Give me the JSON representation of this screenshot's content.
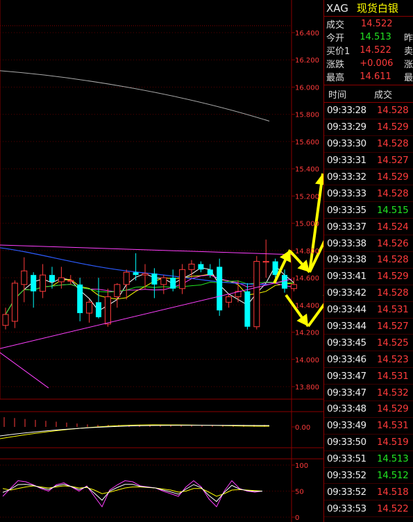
{
  "symbol": {
    "code": "XAG",
    "name": "现货白银"
  },
  "quote": [
    {
      "label": "成交",
      "value": "14.522",
      "color": "#ff3b3b",
      "extra": ""
    },
    {
      "label": "今开",
      "value": "14.513",
      "color": "#22e322",
      "extra": "昨"
    },
    {
      "label": "买价1",
      "value": "14.522",
      "color": "#ff3b3b",
      "extra": "卖"
    },
    {
      "label": "涨跌",
      "value": "+0.006",
      "color": "#ff3b3b",
      "extra": "涨"
    },
    {
      "label": "最高",
      "value": "14.611",
      "color": "#ff3b3b",
      "extra": "最"
    }
  ],
  "trades_header": {
    "time": "时间",
    "price": "成交"
  },
  "trades": [
    {
      "time": "09:33:28",
      "price": "14.528",
      "dir": "up"
    },
    {
      "time": "09:33:29",
      "price": "14.529",
      "dir": "up"
    },
    {
      "time": "09:33:30",
      "price": "14.528",
      "dir": "up"
    },
    {
      "time": "09:33:31",
      "price": "14.527",
      "dir": "up"
    },
    {
      "time": "09:33:32",
      "price": "14.529",
      "dir": "up"
    },
    {
      "time": "09:33:33",
      "price": "14.528",
      "dir": "up"
    },
    {
      "time": "09:33:35",
      "price": "14.515",
      "dir": "down"
    },
    {
      "time": "09:33:37",
      "price": "14.524",
      "dir": "up"
    },
    {
      "time": "09:33:38",
      "price": "14.526",
      "dir": "up"
    },
    {
      "time": "09:33:38",
      "price": "14.528",
      "dir": "up"
    },
    {
      "time": "09:33:41",
      "price": "14.529",
      "dir": "up"
    },
    {
      "time": "09:33:42",
      "price": "14.528",
      "dir": "up"
    },
    {
      "time": "09:33:44",
      "price": "14.531",
      "dir": "up"
    },
    {
      "time": "09:33:44",
      "price": "14.527",
      "dir": "up"
    },
    {
      "time": "09:33:45",
      "price": "14.525",
      "dir": "up"
    },
    {
      "time": "09:33:46",
      "price": "14.523",
      "dir": "up"
    },
    {
      "time": "09:33:47",
      "price": "14.531",
      "dir": "up"
    },
    {
      "time": "09:33:47",
      "price": "14.532",
      "dir": "up"
    },
    {
      "time": "09:33:48",
      "price": "14.529",
      "dir": "up"
    },
    {
      "time": "09:33:49",
      "price": "14.531",
      "dir": "up"
    },
    {
      "time": "09:33:50",
      "price": "14.519",
      "dir": "up"
    },
    {
      "time": "09:33:51",
      "price": "14.513",
      "dir": "down"
    },
    {
      "time": "09:33:52",
      "price": "14.512",
      "dir": "down"
    },
    {
      "time": "09:33:52",
      "price": "14.518",
      "dir": "up"
    },
    {
      "time": "09:33:53",
      "price": "14.522",
      "dir": "up"
    }
  ],
  "chart_data": {
    "type": "candlestick",
    "price_axis": {
      "ticks": [
        "16.400",
        "16.200",
        "16.000",
        "15.800",
        "15.600",
        "15.400",
        "15.200",
        "15.000",
        "14.800",
        "14.600",
        "14.400",
        "14.200",
        "14.000",
        "13.800"
      ],
      "min": 13.8,
      "max": 16.4
    },
    "candles": [
      {
        "o": 14.25,
        "h": 14.38,
        "l": 14.22,
        "c": 14.33
      },
      {
        "o": 14.28,
        "h": 14.58,
        "l": 14.23,
        "c": 14.56
      },
      {
        "o": 14.55,
        "h": 14.75,
        "l": 14.42,
        "c": 14.65
      },
      {
        "o": 14.62,
        "h": 14.64,
        "l": 14.38,
        "c": 14.5
      },
      {
        "o": 14.5,
        "h": 14.7,
        "l": 14.45,
        "c": 14.62
      },
      {
        "o": 14.62,
        "h": 14.68,
        "l": 14.52,
        "c": 14.57
      },
      {
        "o": 14.57,
        "h": 14.68,
        "l": 14.52,
        "c": 14.6
      },
      {
        "o": 14.58,
        "h": 14.62,
        "l": 14.55,
        "c": 14.58
      },
      {
        "o": 14.55,
        "h": 14.6,
        "l": 14.28,
        "c": 14.34
      },
      {
        "o": 14.34,
        "h": 14.44,
        "l": 14.27,
        "c": 14.42
      },
      {
        "o": 14.42,
        "h": 14.6,
        "l": 14.3,
        "c": 14.31
      },
      {
        "o": 14.26,
        "h": 14.52,
        "l": 14.24,
        "c": 14.46
      },
      {
        "o": 14.46,
        "h": 14.56,
        "l": 14.38,
        "c": 14.55
      },
      {
        "o": 14.55,
        "h": 14.66,
        "l": 14.44,
        "c": 14.64
      },
      {
        "o": 14.64,
        "h": 14.78,
        "l": 14.58,
        "c": 14.62
      },
      {
        "o": 14.62,
        "h": 14.7,
        "l": 14.52,
        "c": 14.63
      },
      {
        "o": 14.63,
        "h": 14.67,
        "l": 14.45,
        "c": 14.55
      },
      {
        "o": 14.55,
        "h": 14.62,
        "l": 14.48,
        "c": 14.6
      },
      {
        "o": 14.6,
        "h": 14.66,
        "l": 14.5,
        "c": 14.52
      },
      {
        "o": 14.52,
        "h": 14.7,
        "l": 14.48,
        "c": 14.66
      },
      {
        "o": 14.66,
        "h": 14.73,
        "l": 14.6,
        "c": 14.7
      },
      {
        "o": 14.7,
        "h": 14.72,
        "l": 14.64,
        "c": 14.66
      },
      {
        "o": 14.66,
        "h": 14.7,
        "l": 14.6,
        "c": 14.62
      },
      {
        "o": 14.68,
        "h": 14.74,
        "l": 14.32,
        "c": 14.36
      },
      {
        "o": 14.42,
        "h": 14.48,
        "l": 14.38,
        "c": 14.46
      },
      {
        "o": 14.46,
        "h": 14.58,
        "l": 14.42,
        "c": 14.5
      },
      {
        "o": 14.5,
        "h": 14.56,
        "l": 14.22,
        "c": 14.24
      },
      {
        "o": 14.24,
        "h": 14.76,
        "l": 14.22,
        "c": 14.72
      },
      {
        "o": 14.72,
        "h": 14.88,
        "l": 14.6,
        "c": 14.72
      },
      {
        "o": 14.72,
        "h": 14.74,
        "l": 14.6,
        "c": 14.62
      },
      {
        "o": 14.62,
        "h": 14.66,
        "l": 14.49,
        "c": 14.52
      },
      {
        "o": 14.52,
        "h": 14.6,
        "l": 14.5,
        "c": 14.55
      }
    ],
    "macd_axis": {
      "label": "0.00"
    },
    "kdj_axis": {
      "ticks": [
        "100",
        "50",
        "0"
      ]
    },
    "colors": {
      "up": "#ff3b3b",
      "down": "#00ffff",
      "border": "#8b0000",
      "trend": "#ff40ff",
      "arrow": "#ffff00"
    }
  }
}
